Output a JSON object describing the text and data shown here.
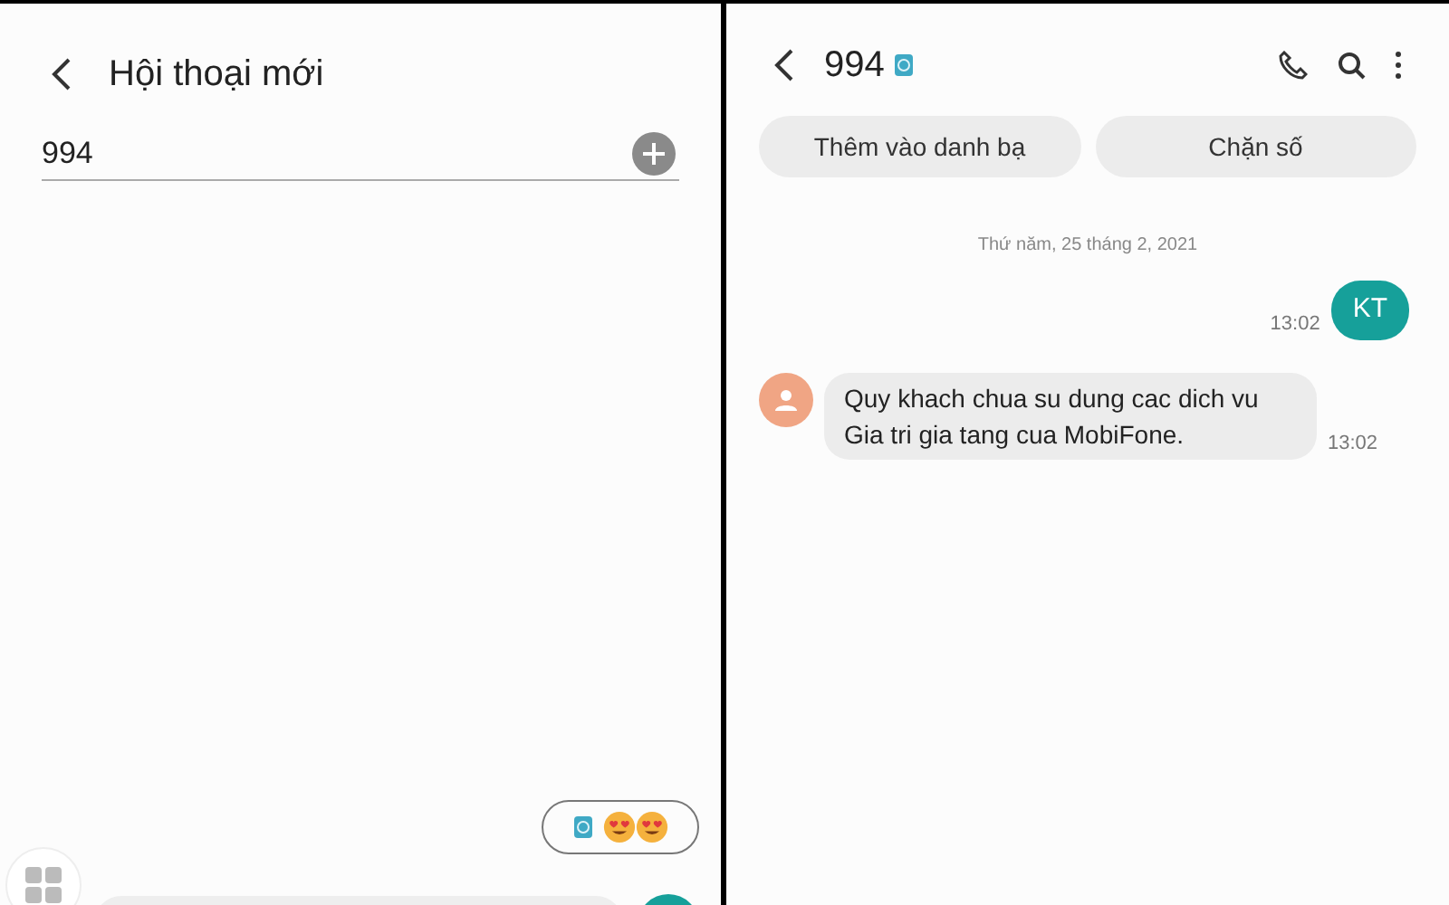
{
  "new_conversation": {
    "title": "Hội thoại mới",
    "recipient_value": "994"
  },
  "conversation": {
    "title": "994",
    "actions": [
      {
        "label": "Thêm vào danh bạ"
      },
      {
        "label": "Chặn số"
      }
    ],
    "date_divider": "Thứ năm, 25 tháng 2, 2021",
    "messages": [
      {
        "kind": "sent",
        "text": "KT",
        "time": "13:02"
      },
      {
        "kind": "received",
        "text": "Quy khach chua su dung cac dich vu Gia tri gia tang cua MobiFone.",
        "time": "13:02"
      }
    ]
  }
}
